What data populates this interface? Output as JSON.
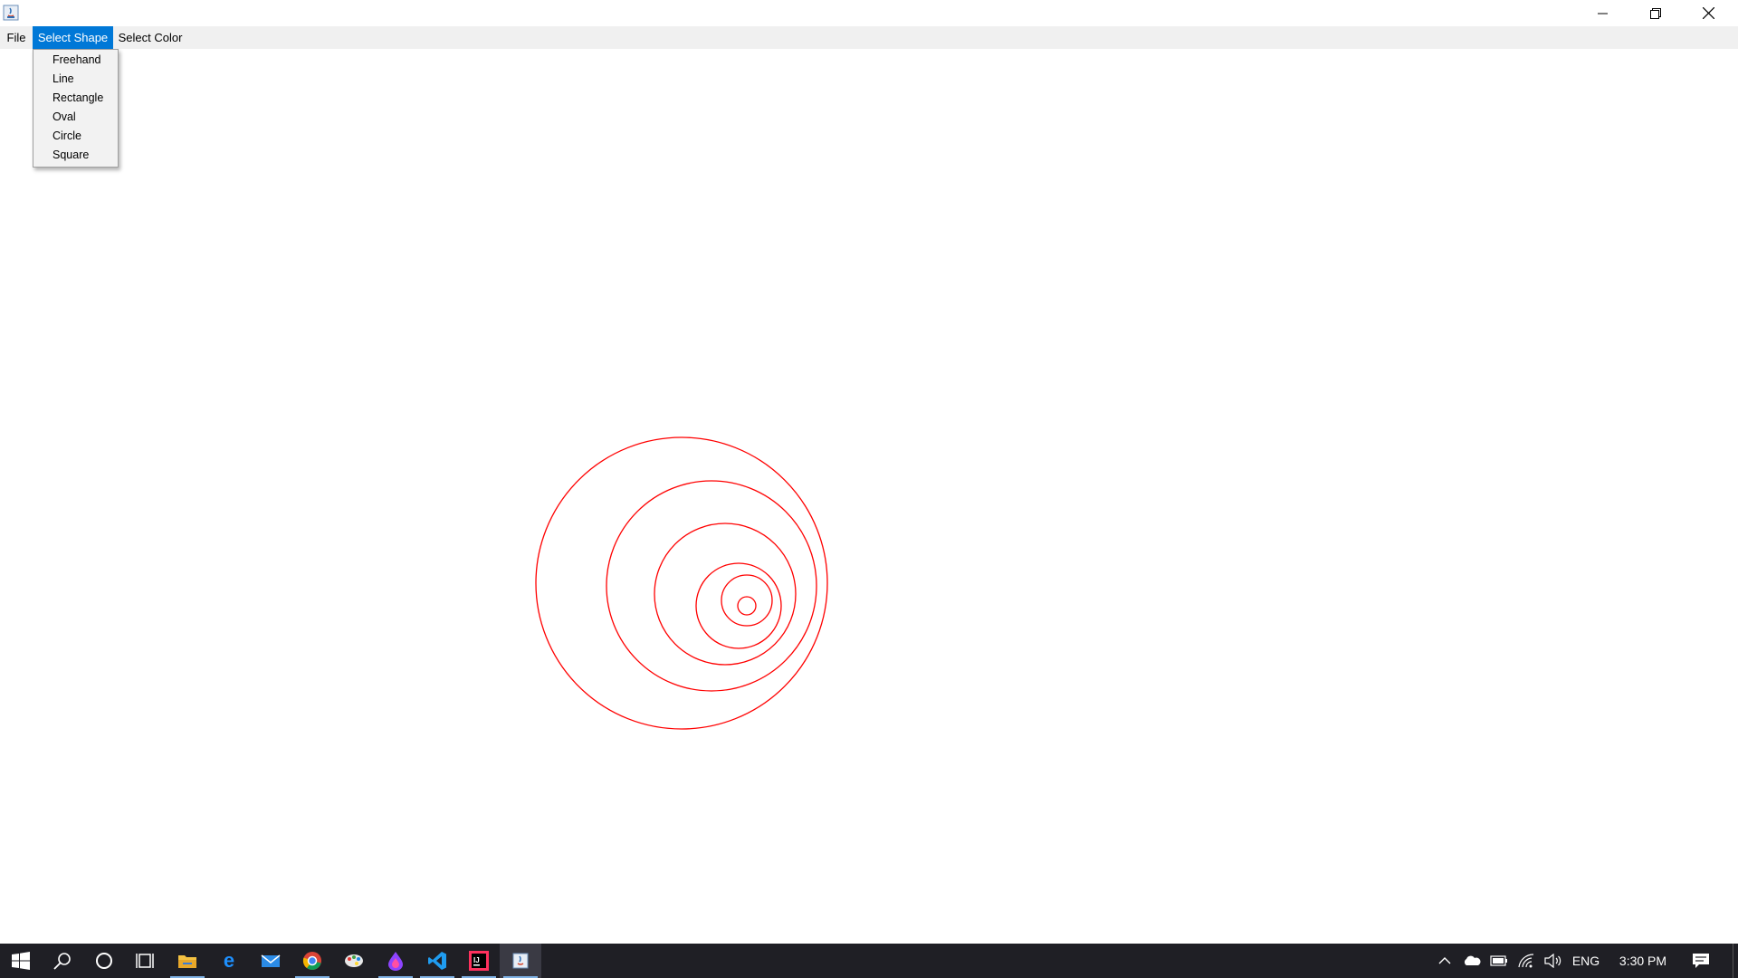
{
  "window": {
    "icon": "java-app-icon",
    "controls": [
      "minimize-icon",
      "restore-icon",
      "close-icon"
    ]
  },
  "menubar": {
    "items": [
      {
        "label": "File"
      },
      {
        "label": "Select Shape"
      },
      {
        "label": "Select Color"
      }
    ],
    "active_index": 1
  },
  "dropdown": {
    "items": [
      "Freehand",
      "Line",
      "Rectangle",
      "Oval",
      "Circle",
      "Square"
    ]
  },
  "canvas": {
    "stroke_color": "#ff0000",
    "shapes": "concentric-circles"
  },
  "taskbar": {
    "apps": [
      "start-icon",
      "search-icon",
      "cortana-icon",
      "task-view-icon",
      "file-explorer-icon",
      "edge-icon",
      "mail-icon",
      "chrome-icon",
      "paint-icon",
      "drop-app-icon",
      "vscode-icon",
      "intellij-icon",
      "java-app-icon"
    ],
    "tray": {
      "language": "ENG",
      "time": "3:30 PM"
    }
  },
  "colors": {
    "menu_active": "#0078d7",
    "taskbar": "#1f1f25",
    "shape_stroke": "#ff0000"
  }
}
